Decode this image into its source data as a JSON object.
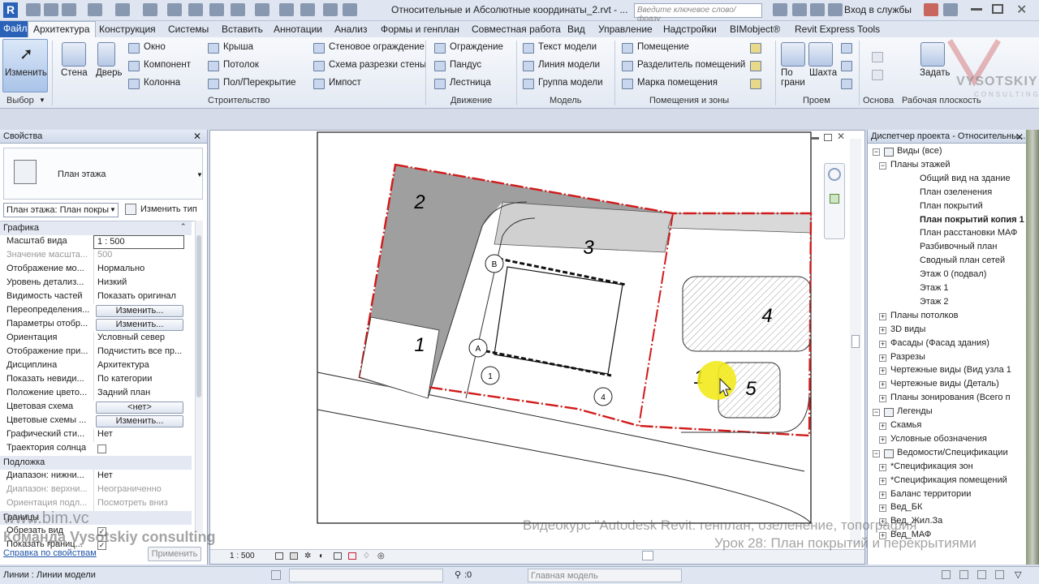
{
  "app": {
    "title": "Относительные и Абсолютные координаты_2.rvt - ...",
    "search_placeholder": "Введите ключевое слово/фразу",
    "login": "Вход в службы"
  },
  "tabs": [
    "Файл",
    "Архитектура",
    "Конструкция",
    "Системы",
    "Вставить",
    "Аннотации",
    "Анализ",
    "Формы и генплан",
    "Совместная работа",
    "Вид",
    "Управление",
    "Надстройки",
    "BIMobject®",
    "Revit Express Tools"
  ],
  "active_tab": "Архитектура",
  "ribbon": {
    "modify": "Изменить",
    "wall": "Стена",
    "door": "Дверь",
    "window": "Окно",
    "component": "Компонент",
    "column": "Колонна",
    "roof": "Крыша",
    "ceiling": "Потолок",
    "floor": "Пол/Перекрытие",
    "curtain_system": "Стеновое ограждение",
    "curtain_grid": "Схема разрезки стены",
    "mullion": "Импост",
    "railing": "Ограждение",
    "ramp": "Пандус",
    "stair": "Лестница",
    "model_text": "Текст модели",
    "model_line": "Линия модели",
    "model_group": "Группа модели",
    "room": "Помещение",
    "room_separator": "Разделитель помещений",
    "room_tag": "Марка помещения",
    "by_face": "По грани",
    "shaft": "Шахта",
    "set": "Задать",
    "panels": {
      "select": "Выбор",
      "build": "Строительство",
      "circulation": "Движение",
      "model": "Модель",
      "rooms": "Помещения и зоны",
      "opening": "Проем",
      "datum": "Основа",
      "workplane": "Рабочая плоскость"
    }
  },
  "properties": {
    "title": "Свойства",
    "type_name": "План этажа",
    "selector": "План этажа: План покры",
    "edit_type": "Изменить тип",
    "sections": {
      "graphics": "Графика",
      "underlay": "Подложка",
      "extents": "Границы"
    },
    "rows": [
      {
        "k": "Масштаб вида",
        "v": "1 : 500"
      },
      {
        "k": "Значение масшта...",
        "v": "500"
      },
      {
        "k": "Отображение мо...",
        "v": "Нормально"
      },
      {
        "k": "Уровень детализ...",
        "v": "Низкий"
      },
      {
        "k": "Видимость частей",
        "v": "Показать оригинал"
      },
      {
        "k": "Переопределения...",
        "v": "Изменить..."
      },
      {
        "k": "Параметры отобр...",
        "v": "Изменить..."
      },
      {
        "k": "Ориентация",
        "v": "Условный север"
      },
      {
        "k": "Отображение при...",
        "v": "Подчистить все пр..."
      },
      {
        "k": "Дисциплина",
        "v": "Архитектура"
      },
      {
        "k": "Показать невиди...",
        "v": "По категории"
      },
      {
        "k": "Положение цвето...",
        "v": "Задний план"
      },
      {
        "k": "Цветовая схема",
        "v": "<нет>"
      },
      {
        "k": "Цветовые схемы ...",
        "v": "Изменить..."
      },
      {
        "k": "Графический сти...",
        "v": "Нет"
      },
      {
        "k": "Траектория солнца",
        "v": ""
      }
    ],
    "underlay_rows": [
      {
        "k": "Диапазон: нижни...",
        "v": "Нет"
      },
      {
        "k": "Диапазон: верхни...",
        "v": "Неограниченно"
      },
      {
        "k": "Ориентация подл...",
        "v": "Посмотреть вниз"
      }
    ],
    "extents_rows": [
      {
        "k": "Обрезать вид",
        "v": ""
      },
      {
        "k": "Показать границ...",
        "v": ""
      }
    ],
    "help_link": "Справка по свойствам",
    "apply": "Применить"
  },
  "canvas": {
    "labels": [
      "1",
      "2",
      "3",
      "4",
      "5",
      "1"
    ],
    "grid_labels": [
      "B",
      "A",
      "1",
      "4"
    ],
    "scale": "1 : 500"
  },
  "browser": {
    "title": "Диспетчер проекта - Относительны...",
    "items": [
      {
        "t": "Виды (все)",
        "lvl": 0
      },
      {
        "t": "Планы этажей",
        "lvl": 1
      },
      {
        "t": "Общий вид на здание",
        "lvl": 2
      },
      {
        "t": "План озеленения",
        "lvl": 2
      },
      {
        "t": "План покрытий",
        "lvl": 2
      },
      {
        "t": "План покрытий копия 1",
        "lvl": 2,
        "bold": true
      },
      {
        "t": "План расстановки МАФ",
        "lvl": 2
      },
      {
        "t": "Разбивочный план",
        "lvl": 2
      },
      {
        "t": "Сводный план сетей",
        "lvl": 2
      },
      {
        "t": "Этаж 0 (подвал)",
        "lvl": 2
      },
      {
        "t": "Этаж 1",
        "lvl": 2
      },
      {
        "t": "Этаж 2",
        "lvl": 2
      },
      {
        "t": "Планы потолков",
        "lvl": 1
      },
      {
        "t": "3D виды",
        "lvl": 1
      },
      {
        "t": "Фасады (Фасад здания)",
        "lvl": 1
      },
      {
        "t": "Разрезы",
        "lvl": 1
      },
      {
        "t": "Чертежные виды (Вид узла 1",
        "lvl": 1
      },
      {
        "t": "Чертежные виды (Деталь)",
        "lvl": 1
      },
      {
        "t": "Планы зонирования (Всего п",
        "lvl": 1
      },
      {
        "t": "Легенды",
        "lvl": 0
      },
      {
        "t": "Скамья",
        "lvl": 1
      },
      {
        "t": "Условные обозначения",
        "lvl": 1
      },
      {
        "t": "Ведомости/Спецификации",
        "lvl": 0
      },
      {
        "t": "*Спецификация зон",
        "lvl": 1
      },
      {
        "t": "*Спецификация помещений",
        "lvl": 1
      },
      {
        "t": "Баланс территории",
        "lvl": 1
      },
      {
        "t": "Вед_БК",
        "lvl": 1
      },
      {
        "t": "Вед_Жил.За",
        "lvl": 1
      },
      {
        "t": "Вед_МАФ",
        "lvl": 1
      }
    ]
  },
  "status": {
    "text": "Линии : Линии модели",
    "zero": ":0",
    "model": "Главная модель"
  },
  "watermark": {
    "site": "www.bim.vc",
    "team": "Команда Vysotskiy consulting",
    "course": "Видеокурс \"Autodesk Revit: генплан, озеленение, топография\"",
    "lesson": "Урок 28: План покрытий и перекрытиями",
    "logo": "VYSOTSKIY",
    "logo_sub": "CONSULTING"
  }
}
